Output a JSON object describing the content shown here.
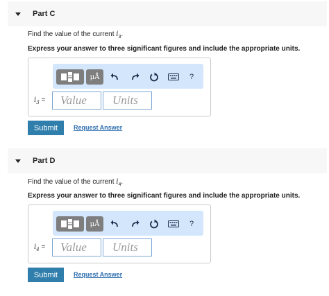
{
  "parts": [
    {
      "title": "Part C",
      "prompt_prefix": "Find the value of the current ",
      "prompt_var": "i",
      "prompt_sub": "3",
      "prompt_suffix": ".",
      "instruction": "Express your answer to three significant figures and include the appropriate units.",
      "var_label": "i",
      "var_sub": "3",
      "equals": " =",
      "value_placeholder": "Value",
      "units_placeholder": "Units",
      "submit_label": "Submit",
      "request_label": "Request Answer"
    },
    {
      "title": "Part D",
      "prompt_prefix": "Find the value of the current ",
      "prompt_var": "i",
      "prompt_sub": "4",
      "prompt_suffix": ".",
      "instruction": "Express your answer to three significant figures and include the appropriate units.",
      "var_label": "i",
      "var_sub": "4",
      "equals": " =",
      "value_placeholder": "Value",
      "units_placeholder": "Units",
      "submit_label": "Submit",
      "request_label": "Request Answer"
    }
  ],
  "toolbar": {
    "mu_label": "μÅ",
    "help_label": "?",
    "icons": [
      "templates-icon",
      "units-icon",
      "undo-icon",
      "redo-icon",
      "reset-icon",
      "keyboard-icon",
      "help-icon"
    ]
  },
  "colors": {
    "submit_bg": "#2f7eab",
    "link": "#2f6fb0",
    "toolbar_bg": "#d4e6fb",
    "field_border": "#7aa6d6"
  }
}
